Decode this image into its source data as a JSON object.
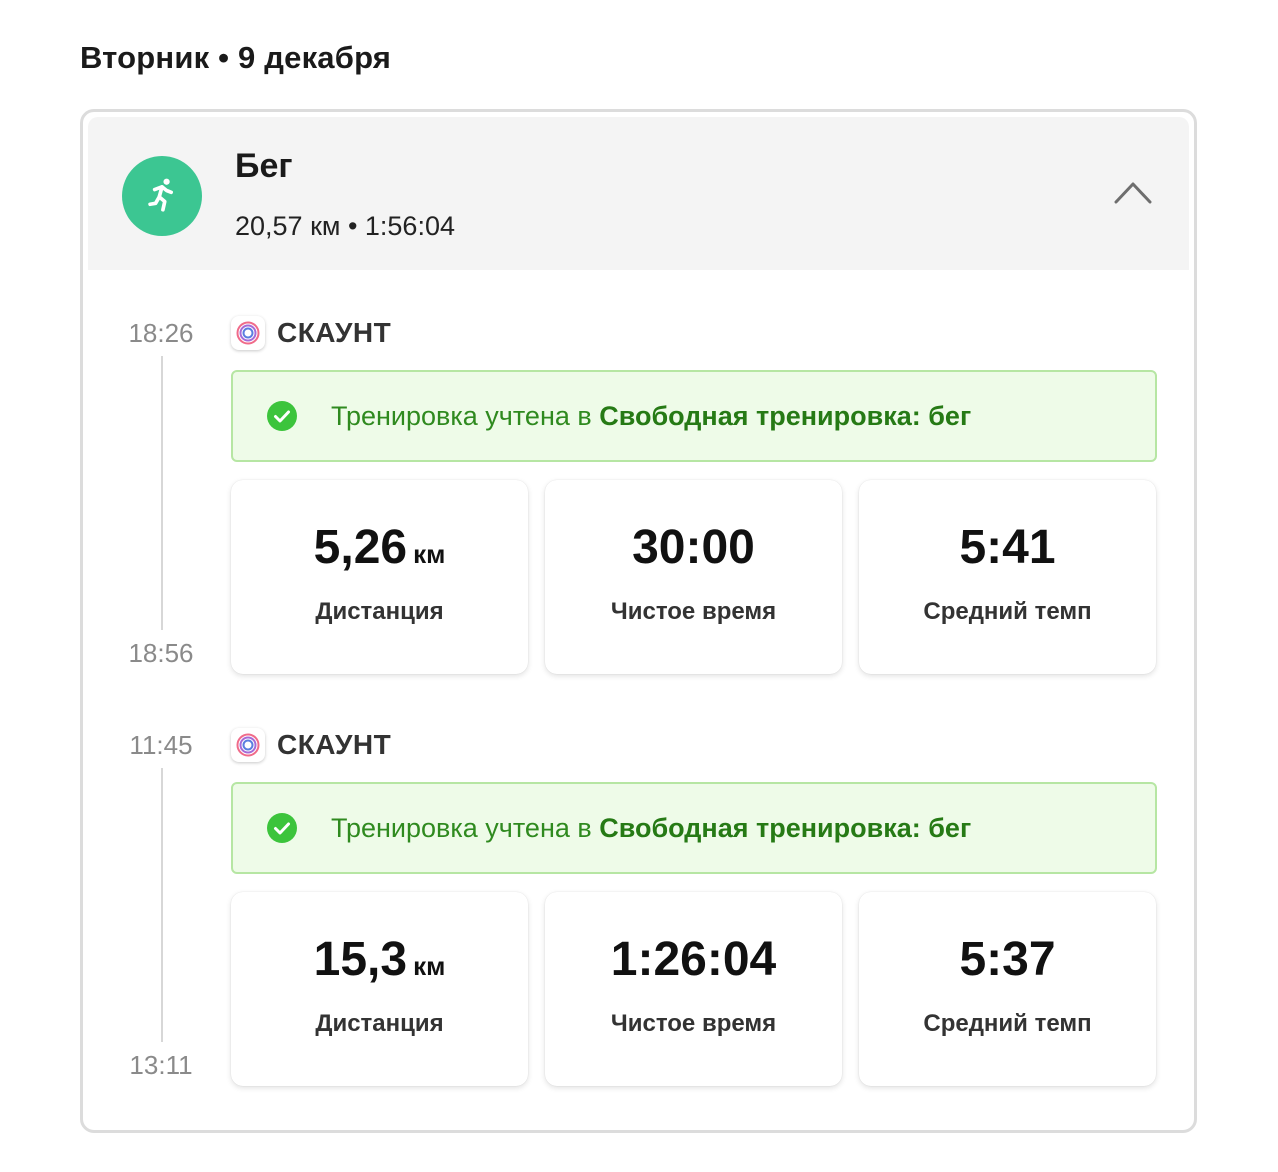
{
  "day": {
    "heading": "Вторник • 9 декабря"
  },
  "activity": {
    "title": "Бег",
    "summary": "20,57 км • 1:56:04",
    "icon": "running-person-icon",
    "accent_color": "#3cc692"
  },
  "workouts": [
    {
      "time_start": "18:26",
      "time_end": "18:56",
      "source_name": "СКАУНТ",
      "status_prefix": "Тренировка учтена в ",
      "status_program": "Свободная тренировка: бег",
      "stats": [
        {
          "value": "5,26",
          "unit": "км",
          "label": "Дистанция"
        },
        {
          "value": "30:00",
          "unit": "",
          "label": "Чистое время"
        },
        {
          "value": "5:41",
          "unit": "",
          "label": "Средний темп"
        }
      ]
    },
    {
      "time_start": "11:45",
      "time_end": "13:11",
      "source_name": "СКАУНТ",
      "status_prefix": "Тренировка учтена в ",
      "status_program": "Свободная тренировка: бег",
      "stats": [
        {
          "value": "15,3",
          "unit": "км",
          "label": "Дистанция"
        },
        {
          "value": "1:26:04",
          "unit": "",
          "label": "Чистое время"
        },
        {
          "value": "5:37",
          "unit": "",
          "label": "Средний темп"
        }
      ]
    }
  ],
  "colors": {
    "status_bg": "#eefbe8",
    "status_border": "#b6e6a3",
    "status_text": "#2f8a1f",
    "check": "#3cc43c"
  }
}
